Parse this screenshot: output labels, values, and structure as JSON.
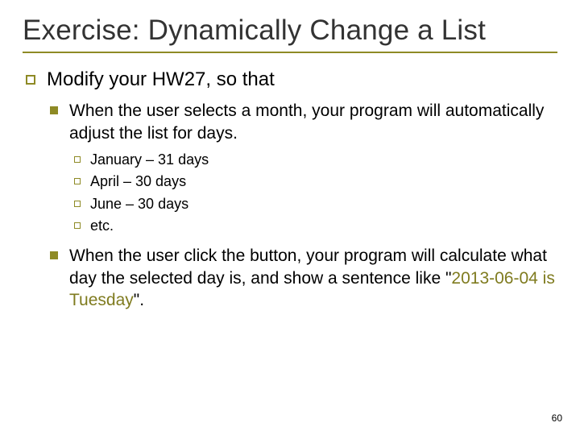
{
  "title": "Exercise: Dynamically Change a List",
  "lvl1": {
    "text": "Modify your HW27, so that"
  },
  "lvl2a": {
    "text": "When the user selects a month, your program will automatically adjust the list for days."
  },
  "lvl3": [
    "January – 31 days",
    "April – 30 days",
    "June – 30 days",
    "etc."
  ],
  "lvl2b": {
    "prefix": "When the user click the button, your program will calculate what day the selected day is, and show a sentence like \"",
    "highlight": "2013-06-04 is Tuesday",
    "suffix": "\"."
  },
  "page": "60"
}
